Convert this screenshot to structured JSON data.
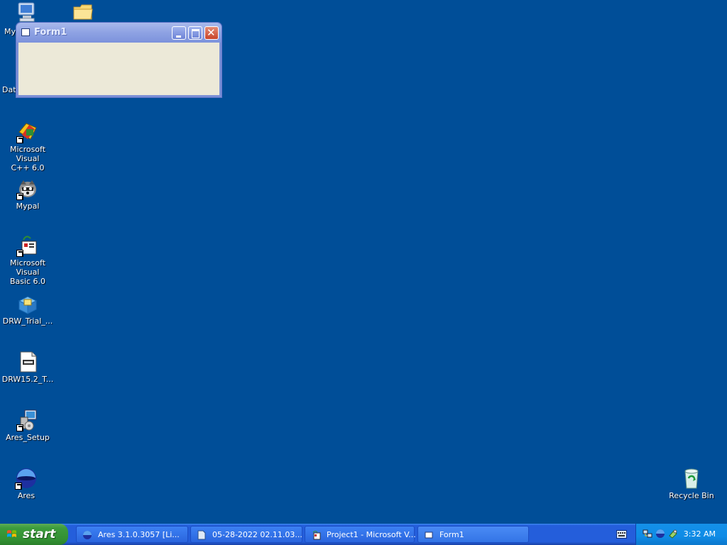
{
  "desktop": {
    "background_color": "#004e98",
    "icons": [
      {
        "name": "My",
        "icon": "my-computer-icon"
      },
      {
        "name": "",
        "icon": "folder-icon"
      },
      {
        "name": "Dat",
        "icon": "data-icon"
      },
      {
        "name": "Microsoft Visual\nC++ 6.0",
        "icon": "visual-cpp-icon"
      },
      {
        "name": "Mypal",
        "icon": "mypal-icon"
      },
      {
        "name": "Microsoft Visual\nBasic 6.0",
        "icon": "visual-basic-icon"
      },
      {
        "name": "DRW_Trial_...",
        "icon": "installer-package-icon"
      },
      {
        "name": "DRW15.2_T...",
        "icon": "document-file-icon"
      },
      {
        "name": "Ares_Setup",
        "icon": "setup-icon"
      },
      {
        "name": "Ares",
        "icon": "ares-icon"
      },
      {
        "name": "Recycle Bin",
        "icon": "recycle-bin-icon"
      }
    ]
  },
  "window": {
    "title": "Form1",
    "buttons": [
      "minimize",
      "maximize",
      "close"
    ]
  },
  "taskbar": {
    "start_label": "start",
    "tasks": [
      {
        "label": "Ares 3.1.0.3057   [Li...",
        "icon": "ares-icon"
      },
      {
        "label": "05-28-2022 02.11.03...",
        "icon": "document-icon"
      },
      {
        "label": "Project1 - Microsoft V...",
        "icon": "visual-basic-icon"
      },
      {
        "label": "Form1",
        "icon": "form-icon"
      }
    ],
    "clock": "3:32 AM"
  },
  "colors": {
    "taskbar": "#245edb",
    "start_button": "#3c9c3c",
    "tray": "#0f8ce6",
    "window_title": "#8ea2e3",
    "window_client": "#ece9d8"
  }
}
